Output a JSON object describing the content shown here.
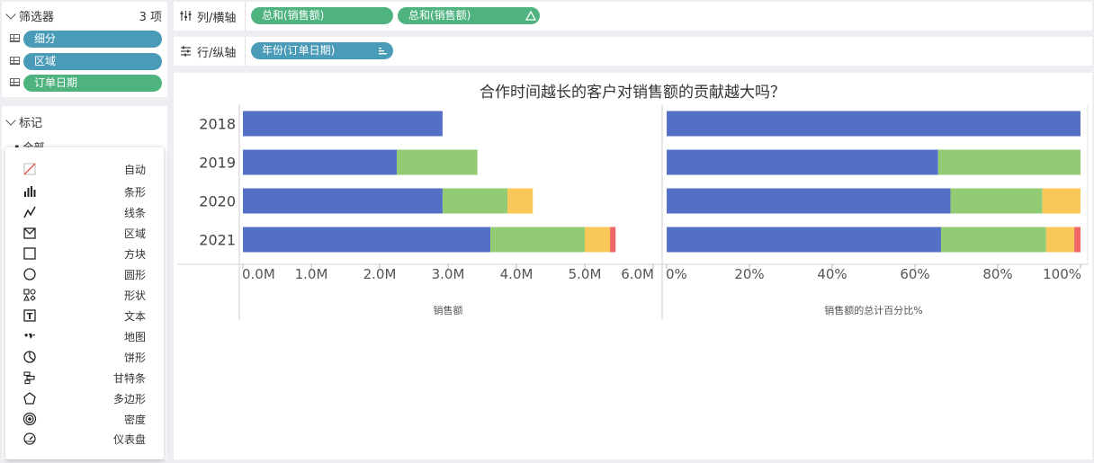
{
  "filters": {
    "title": "筛选器",
    "count": "3 项",
    "items": [
      {
        "label": "细分",
        "color": "#4a9bb7"
      },
      {
        "label": "区域",
        "color": "#4a9bb7"
      },
      {
        "label": "订单日期",
        "color": "#4eb37f"
      }
    ]
  },
  "marks": {
    "title": "标记",
    "all_label": "全部",
    "menu": [
      {
        "label": "自动",
        "icon": "auto-icon"
      },
      {
        "label": "条形",
        "icon": "bar-icon"
      },
      {
        "label": "线条",
        "icon": "line-icon"
      },
      {
        "label": "区域",
        "icon": "area-icon"
      },
      {
        "label": "方块",
        "icon": "square-icon"
      },
      {
        "label": "圆形",
        "icon": "circle-icon"
      },
      {
        "label": "形状",
        "icon": "shape-icon"
      },
      {
        "label": "文本",
        "icon": "text-icon"
      },
      {
        "label": "地图",
        "icon": "map-icon"
      },
      {
        "label": "饼形",
        "icon": "pie-icon"
      },
      {
        "label": "甘特条",
        "icon": "gantt-icon"
      },
      {
        "label": "多边形",
        "icon": "polygon-icon"
      },
      {
        "label": "密度",
        "icon": "density-icon"
      },
      {
        "label": "仪表盘",
        "icon": "gauge-icon"
      }
    ]
  },
  "columns_shelf": {
    "label": "列/横轴",
    "pills": [
      {
        "label": "总和(销售额)",
        "color": "#4eb37f"
      },
      {
        "label": "总和(销售额)",
        "color": "#4eb37f",
        "has_delta": true
      }
    ]
  },
  "rows_shelf": {
    "label": "行/纵轴",
    "pills": [
      {
        "label": "年份(订单日期)",
        "color": "#4a9bb7"
      }
    ]
  },
  "chart_data": [
    {
      "type": "bar",
      "orientation": "horizontal",
      "stacked": true,
      "title": "合作时间越长的客户对销售额的贡献越大吗？",
      "categories": [
        "2018",
        "2019",
        "2020",
        "2021"
      ],
      "series": [
        {
          "color": "#5470c6",
          "values": [
            2.92,
            2.25,
            2.92,
            3.62
          ]
        },
        {
          "color": "#91cc75",
          "values": [
            0,
            1.18,
            0.95,
            1.38
          ]
        },
        {
          "color": "#fac858",
          "values": [
            0,
            0,
            0.37,
            0.37
          ]
        },
        {
          "color": "#ee6666",
          "values": [
            0,
            0,
            0,
            0.08
          ]
        }
      ],
      "xlabel": "销售额",
      "xlim": [
        0,
        6
      ],
      "xticks": [
        "0.0M",
        "1.0M",
        "2.0M",
        "3.0M",
        "4.0M",
        "5.0M",
        "6.0M"
      ],
      "grid": false
    },
    {
      "type": "bar",
      "orientation": "horizontal",
      "stacked": true,
      "categories": [
        "2018",
        "2019",
        "2020",
        "2021"
      ],
      "series": [
        {
          "color": "#5470c6",
          "values": [
            100,
            65.6,
            68.6,
            66.3
          ]
        },
        {
          "color": "#91cc75",
          "values": [
            0,
            34.4,
            22.2,
            25.4
          ]
        },
        {
          "color": "#fac858",
          "values": [
            0,
            0,
            9.2,
            6.8
          ]
        },
        {
          "color": "#ee6666",
          "values": [
            0,
            0,
            0,
            1.5
          ]
        }
      ],
      "xlabel": "销售额的总计百分比%",
      "xlim": [
        0,
        100
      ],
      "xticks": [
        "0%",
        "20%",
        "40%",
        "60%",
        "80%",
        "100%"
      ],
      "grid": false
    }
  ]
}
